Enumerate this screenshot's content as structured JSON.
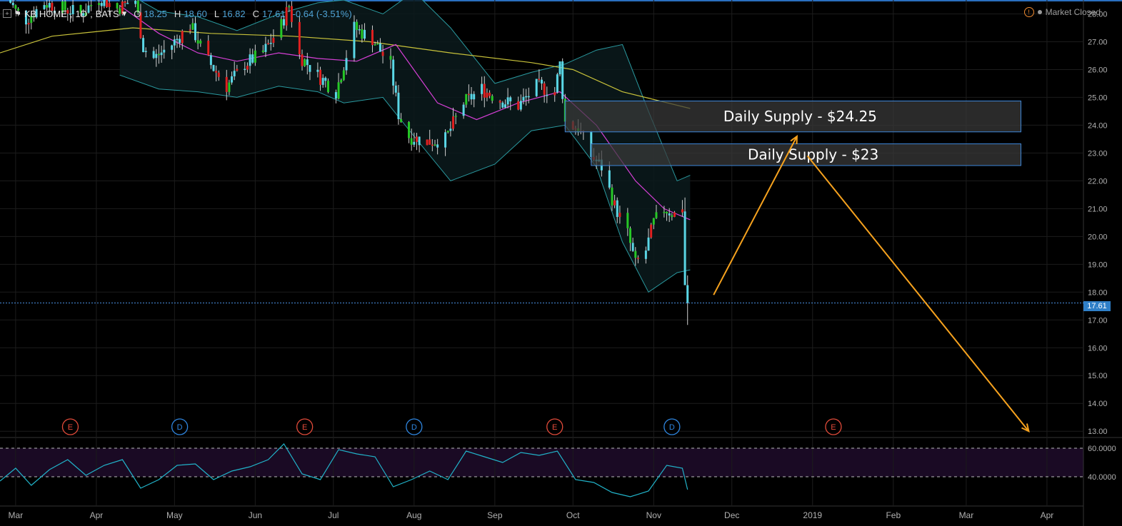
{
  "header": {
    "symbol": "KB HOME",
    "interval": "1D",
    "exchange": "BATS",
    "open_label": "O",
    "open": "18.25",
    "high_label": "H",
    "high": "18.60",
    "low_label": "L",
    "low": "16.82",
    "close_label": "C",
    "close": "17.61",
    "change": "-0.64 (-3.51%)"
  },
  "status": {
    "market": "Market Closed"
  },
  "last_price_tag": "17.61",
  "colors": {
    "up": "#26c826",
    "down": "#e02020",
    "neutral": "#5ad7e6",
    "bollinger": "#2a9aa0",
    "ma_short": "#d63fd6",
    "ma_long": "#c8c23a",
    "zone_border": "#3d86d8",
    "arrow": "#f6a21e",
    "last_price_line": "#4a8fe0",
    "rsi_line": "#21b3c9"
  },
  "chart_data": {
    "type": "candlestick",
    "title": "KB HOME, 1D, BATS",
    "x_axis_labels": [
      "Mar",
      "Apr",
      "May",
      "Jun",
      "Jul",
      "Aug",
      "Sep",
      "Oct",
      "Nov",
      "Dec",
      "2019",
      "Feb",
      "Mar",
      "Apr"
    ],
    "x_range": [
      "2018-02-23",
      "2019-04-15"
    ],
    "y_ticks": [
      "28.00",
      "27.00",
      "26.00",
      "25.00",
      "24.00",
      "23.00",
      "22.00",
      "21.00",
      "20.00",
      "19.00",
      "18.00",
      "17.00",
      "16.00",
      "15.00",
      "14.00",
      "13.00"
    ],
    "ylim": [
      12.8,
      28.5
    ],
    "price_path": [
      [
        "2018-02-26",
        28.6
      ],
      [
        "2018-03-01",
        28.1
      ],
      [
        "2018-03-05",
        27.8
      ],
      [
        "2018-03-12",
        28.4
      ],
      [
        "2018-03-19",
        28.2
      ],
      [
        "2018-03-26",
        28.0
      ],
      [
        "2018-04-02",
        28.6
      ],
      [
        "2018-04-09",
        28.2
      ],
      [
        "2018-04-16",
        28.5
      ],
      [
        "2018-04-19",
        26.8
      ],
      [
        "2018-04-23",
        26.4
      ],
      [
        "2018-04-30",
        26.9
      ],
      [
        "2018-05-07",
        27.6
      ],
      [
        "2018-05-14",
        26.3
      ],
      [
        "2018-05-21",
        25.4
      ],
      [
        "2018-05-28",
        26.2
      ],
      [
        "2018-06-04",
        26.6
      ],
      [
        "2018-06-11",
        27.6
      ],
      [
        "2018-06-14",
        28.3
      ],
      [
        "2018-06-18",
        26.5
      ],
      [
        "2018-06-25",
        25.8
      ],
      [
        "2018-07-02",
        25.2
      ],
      [
        "2018-07-09",
        27.5
      ],
      [
        "2018-07-16",
        27.1
      ],
      [
        "2018-07-23",
        26.1
      ],
      [
        "2018-07-26",
        24.4
      ],
      [
        "2018-07-30",
        23.6
      ],
      [
        "2018-08-06",
        23.4
      ],
      [
        "2018-08-13",
        23.5
      ],
      [
        "2018-08-20",
        24.8
      ],
      [
        "2018-08-27",
        25.3
      ],
      [
        "2018-09-03",
        24.9
      ],
      [
        "2018-09-10",
        24.7
      ],
      [
        "2018-09-17",
        25.4
      ],
      [
        "2018-09-24",
        25.2
      ],
      [
        "2018-09-26",
        26.2
      ],
      [
        "2018-09-28",
        24.1
      ],
      [
        "2018-10-03",
        23.9
      ],
      [
        "2018-10-08",
        22.9
      ],
      [
        "2018-10-12",
        22.5
      ],
      [
        "2018-10-17",
        21.1
      ],
      [
        "2018-10-22",
        20.1
      ],
      [
        "2018-10-25",
        19.0
      ],
      [
        "2018-10-29",
        19.5
      ],
      [
        "2018-11-01",
        20.5
      ],
      [
        "2018-11-05",
        21.0
      ],
      [
        "2018-11-09",
        20.8
      ],
      [
        "2018-11-12",
        21.1
      ],
      [
        "2018-11-13",
        18.25
      ],
      [
        "2018-11-14",
        17.61
      ]
    ],
    "last_close": 17.61,
    "ohlc_last": {
      "open": 18.25,
      "high": 18.6,
      "low": 16.82,
      "close": 17.61
    },
    "ma_long_path": [
      [
        "2018-02-23",
        26.6
      ],
      [
        "2018-03-15",
        27.2
      ],
      [
        "2018-04-15",
        27.5
      ],
      [
        "2018-05-15",
        27.3
      ],
      [
        "2018-06-15",
        27.2
      ],
      [
        "2018-07-15",
        27.0
      ],
      [
        "2018-08-15",
        26.6
      ],
      [
        "2018-09-15",
        26.25
      ],
      [
        "2018-10-01",
        26.0
      ],
      [
        "2018-10-20",
        25.2
      ],
      [
        "2018-11-15",
        24.6
      ]
    ],
    "ma_short_path": [
      [
        "2018-04-10",
        28.3
      ],
      [
        "2018-04-25",
        27.3
      ],
      [
        "2018-05-10",
        26.6
      ],
      [
        "2018-05-25",
        26.3
      ],
      [
        "2018-06-10",
        26.6
      ],
      [
        "2018-06-25",
        26.4
      ],
      [
        "2018-07-10",
        26.3
      ],
      [
        "2018-07-25",
        26.9
      ],
      [
        "2018-08-10",
        24.8
      ],
      [
        "2018-08-25",
        24.2
      ],
      [
        "2018-09-10",
        24.8
      ],
      [
        "2018-09-26",
        25.2
      ],
      [
        "2018-10-10",
        24.0
      ],
      [
        "2018-10-25",
        22.0
      ],
      [
        "2018-11-05",
        21.0
      ],
      [
        "2018-11-15",
        20.6
      ]
    ],
    "bollinger_upper": [
      [
        "2018-04-10",
        28.9
      ],
      [
        "2018-04-25",
        28.1
      ],
      [
        "2018-05-10",
        27.9
      ],
      [
        "2018-05-25",
        27.4
      ],
      [
        "2018-06-10",
        28.0
      ],
      [
        "2018-06-25",
        28.4
      ],
      [
        "2018-07-05",
        28.5
      ],
      [
        "2018-07-20",
        28.0
      ],
      [
        "2018-08-01",
        28.8
      ],
      [
        "2018-08-15",
        27.5
      ],
      [
        "2018-09-01",
        25.5
      ],
      [
        "2018-09-15",
        25.9
      ],
      [
        "2018-09-28",
        26.2
      ],
      [
        "2018-10-10",
        26.7
      ],
      [
        "2018-10-20",
        26.9
      ],
      [
        "2018-10-30",
        24.5
      ],
      [
        "2018-11-10",
        22.0
      ],
      [
        "2018-11-15",
        22.2
      ]
    ],
    "bollinger_lower": [
      [
        "2018-04-10",
        25.8
      ],
      [
        "2018-04-25",
        25.3
      ],
      [
        "2018-05-10",
        25.2
      ],
      [
        "2018-05-25",
        25.0
      ],
      [
        "2018-06-10",
        25.4
      ],
      [
        "2018-06-25",
        25.2
      ],
      [
        "2018-07-05",
        24.8
      ],
      [
        "2018-07-20",
        25.0
      ],
      [
        "2018-08-01",
        23.6
      ],
      [
        "2018-08-15",
        22.0
      ],
      [
        "2018-09-01",
        22.6
      ],
      [
        "2018-09-15",
        23.8
      ],
      [
        "2018-09-28",
        24.0
      ],
      [
        "2018-10-10",
        22.5
      ],
      [
        "2018-10-20",
        19.8
      ],
      [
        "2018-10-30",
        18.0
      ],
      [
        "2018-11-10",
        18.7
      ],
      [
        "2018-11-15",
        18.8
      ]
    ],
    "supply_zones": [
      {
        "label": "Daily Supply - $24.25",
        "price_top": 24.87,
        "price_bottom": 23.76,
        "start": "2018-09-28",
        "end": "2019-03-22"
      },
      {
        "label": "Daily Supply - $23",
        "price_top": 23.33,
        "price_bottom": 22.55,
        "start": "2018-10-08",
        "end": "2019-03-22"
      }
    ],
    "projection_arrows": [
      {
        "from": [
          "2018-11-24",
          17.9
        ],
        "to": [
          "2018-12-26",
          23.6
        ]
      },
      {
        "from": [
          "2018-12-30",
          22.9
        ],
        "to": [
          "2019-03-25",
          13.0
        ]
      }
    ],
    "event_markers": [
      {
        "type": "E",
        "date": "2018-03-22"
      },
      {
        "type": "D",
        "date": "2018-05-03"
      },
      {
        "type": "E",
        "date": "2018-06-20"
      },
      {
        "type": "D",
        "date": "2018-08-01"
      },
      {
        "type": "E",
        "date": "2018-09-24"
      },
      {
        "type": "D",
        "date": "2018-11-08"
      },
      {
        "type": "E",
        "date": "2019-01-09"
      }
    ],
    "rsi": {
      "y_ticks": [
        "60.0000",
        "40.0000"
      ],
      "ylim": [
        20,
        67
      ],
      "band": [
        40,
        60
      ],
      "path": [
        [
          "2018-02-23",
          37
        ],
        [
          "2018-03-01",
          46
        ],
        [
          "2018-03-07",
          34
        ],
        [
          "2018-03-14",
          45
        ],
        [
          "2018-03-21",
          52
        ],
        [
          "2018-03-28",
          41
        ],
        [
          "2018-04-04",
          48
        ],
        [
          "2018-04-11",
          52
        ],
        [
          "2018-04-18",
          32
        ],
        [
          "2018-04-25",
          38
        ],
        [
          "2018-05-02",
          48
        ],
        [
          "2018-05-09",
          49
        ],
        [
          "2018-05-16",
          38
        ],
        [
          "2018-05-23",
          44
        ],
        [
          "2018-05-30",
          47
        ],
        [
          "2018-06-06",
          52
        ],
        [
          "2018-06-12",
          63
        ],
        [
          "2018-06-19",
          42
        ],
        [
          "2018-06-26",
          38
        ],
        [
          "2018-07-03",
          59
        ],
        [
          "2018-07-10",
          56
        ],
        [
          "2018-07-17",
          54
        ],
        [
          "2018-07-24",
          33
        ],
        [
          "2018-07-31",
          38
        ],
        [
          "2018-08-07",
          44
        ],
        [
          "2018-08-14",
          38
        ],
        [
          "2018-08-21",
          58
        ],
        [
          "2018-08-28",
          54
        ],
        [
          "2018-09-04",
          50
        ],
        [
          "2018-09-11",
          57
        ],
        [
          "2018-09-18",
          55
        ],
        [
          "2018-09-25",
          58
        ],
        [
          "2018-10-02",
          38
        ],
        [
          "2018-10-09",
          36
        ],
        [
          "2018-10-16",
          29
        ],
        [
          "2018-10-23",
          26
        ],
        [
          "2018-10-30",
          30
        ],
        [
          "2018-11-06",
          48
        ],
        [
          "2018-11-12",
          46
        ],
        [
          "2018-11-14",
          31
        ]
      ]
    }
  }
}
